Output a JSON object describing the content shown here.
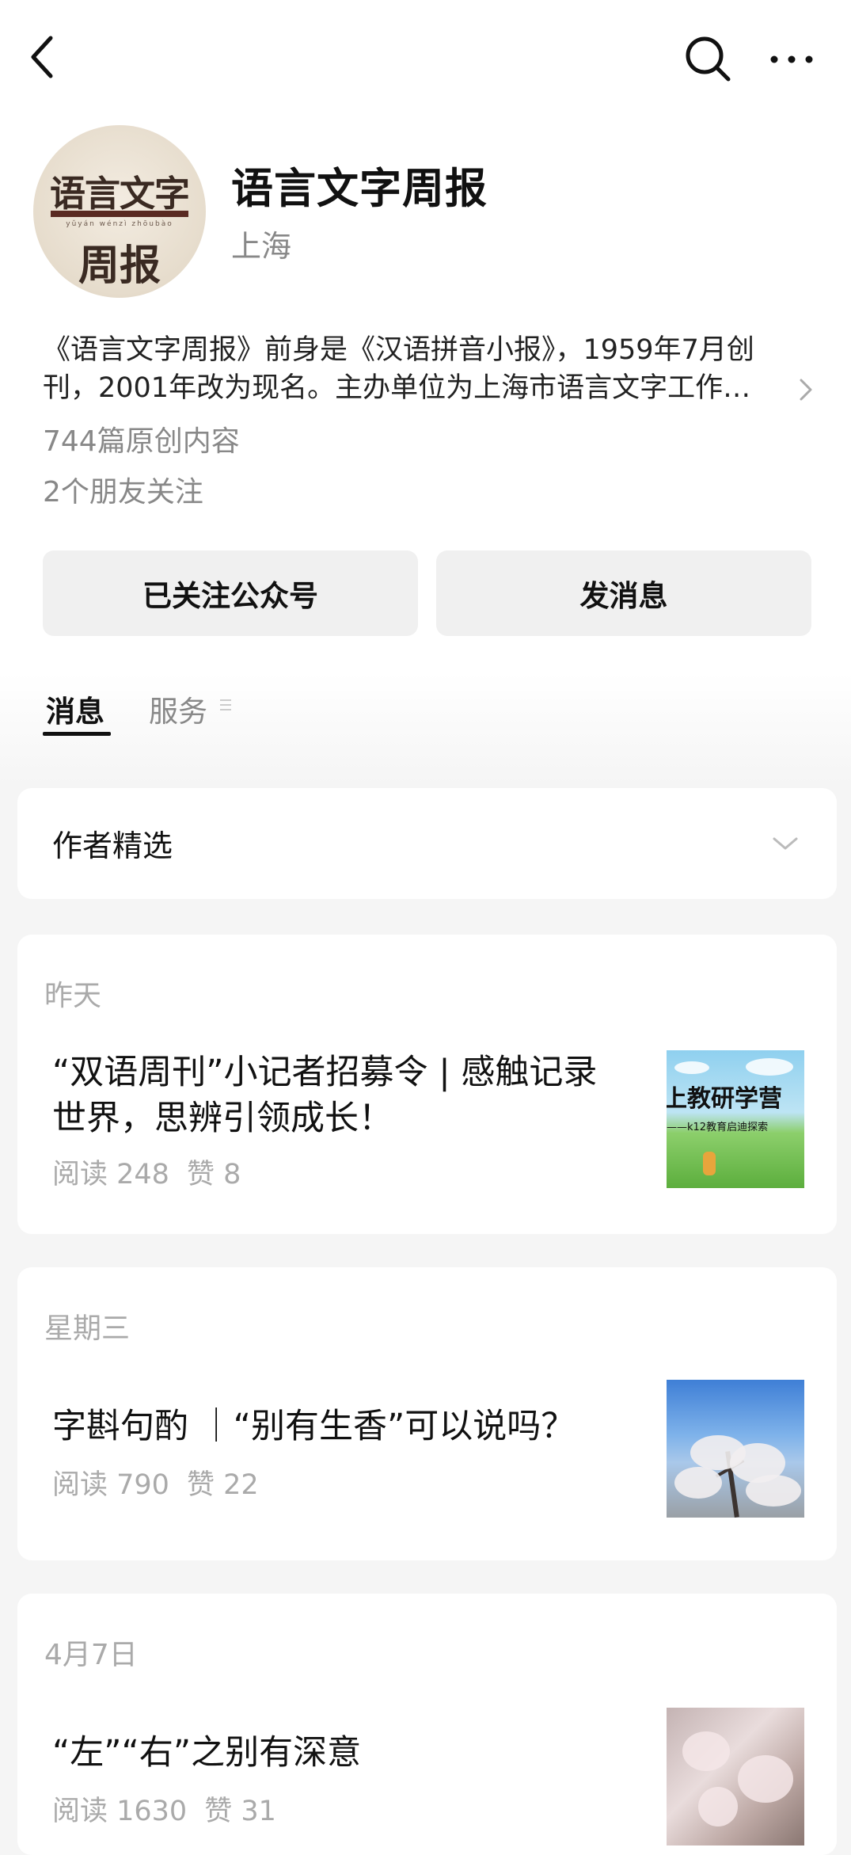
{
  "account": {
    "name": "语言文字周报",
    "location": "上海",
    "avatar_line1": "语言文字",
    "avatar_pinyin": "yǔyán wénzì zhōubào",
    "avatar_line2": "周报",
    "description_line1": "《语言文字周报》前身是《汉语拼音小报》，1959年7月创",
    "description_line2": "刊，2001年改为现名。主办单位为上海市语言文字工作…",
    "original_count": "744篇原创内容",
    "friends_following": "2个朋友关注"
  },
  "actions": {
    "follow_label": "已关注公众号",
    "message_label": "发消息"
  },
  "tabs": [
    {
      "label": "消息",
      "active": true
    },
    {
      "label": "服务",
      "active": false
    }
  ],
  "author_picks": {
    "label": "作者精选"
  },
  "articles": [
    {
      "date": "昨天",
      "title_line1": "“双语周刊”小记者招募令 | 感触记录",
      "title_line2": "世界，思辨引领成长！",
      "reads": "阅读 248",
      "likes": "赞 8",
      "thumb_text": "上教研学营",
      "thumb_subtext": "——k12教育启迪探索"
    },
    {
      "date": "星期三",
      "title_line1": "字斟句酌 ｜“别有生香”可以说吗？",
      "reads": "阅读 790",
      "likes": "赞 22"
    },
    {
      "date": "4月7日",
      "title_line1": "“左”“右”之别有深意",
      "reads": "阅读 1630",
      "likes": "赞 31"
    }
  ],
  "icons": {
    "back": "back-arrow-icon",
    "search": "search-icon",
    "more": "more-icon",
    "chevron_right": "chevron-right-icon",
    "chevron_down": "chevron-down-icon",
    "menu": "menu-icon"
  }
}
